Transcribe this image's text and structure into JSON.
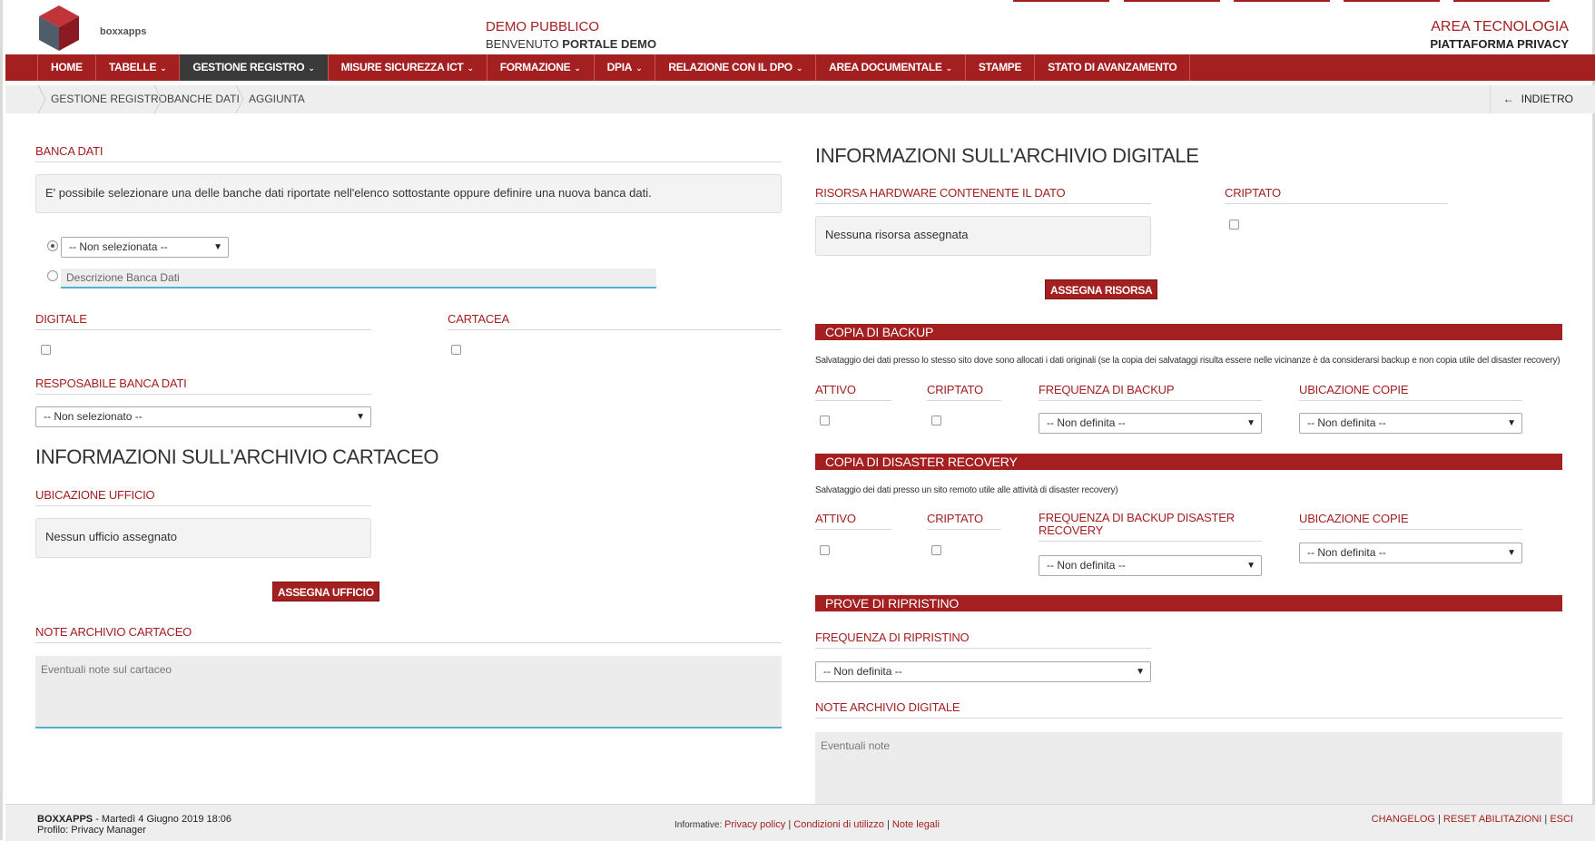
{
  "app": {
    "logo_text": "boxxapps",
    "demo_title": "DEMO PUBBLICO",
    "welcome_prefix": "BENVENUTO",
    "welcome_name": "PORTALE DEMO",
    "area_title": "AREA TECNOLOGIA",
    "area_subtitle": "PIATTAFORMA PRIVACY"
  },
  "nav": {
    "items": [
      {
        "label": "HOME",
        "dropdown": false
      },
      {
        "label": "TABELLE",
        "dropdown": true
      },
      {
        "label": "GESTIONE REGISTRO",
        "dropdown": true,
        "active": true
      },
      {
        "label": "MISURE SICUREZZA ICT",
        "dropdown": true
      },
      {
        "label": "FORMAZIONE",
        "dropdown": true
      },
      {
        "label": "DPIA",
        "dropdown": true
      },
      {
        "label": "RELAZIONE CON IL DPO",
        "dropdown": true
      },
      {
        "label": "AREA DOCUMENTALE",
        "dropdown": true
      },
      {
        "label": "STAMPE",
        "dropdown": false
      },
      {
        "label": "STATO DI AVANZAMENTO",
        "dropdown": false
      }
    ]
  },
  "breadcrumb": {
    "items": [
      "GESTIONE REGISTRO",
      "BANCHE DATI",
      "AGGIUNTA"
    ],
    "back_label": "INDIETRO"
  },
  "left": {
    "banca_dati_title": "BANCA DATI",
    "banca_dati_info": "E' possibile selezionare una delle banche dati riportate nell'elenco sottostante oppure definire una nuova banca dati.",
    "select_value": "-- Non selezionata --",
    "descr_placeholder": "Descrizione Banca Dati",
    "digitale_label": "DIGITALE",
    "cartacea_label": "CARTACEA",
    "responsabile_label": "RESPOSABILE BANCA DATI",
    "responsabile_value": "-- Non selezionato --",
    "archivio_cartaceo_title": "INFORMAZIONI SULL'ARCHIVIO CARTACEO",
    "ubicazione_label": "UBICAZIONE UFFICIO",
    "ubicazione_value": "Nessun ufficio assegnato",
    "assegna_ufficio": "ASSEGNA UFFICIO",
    "note_label": "NOTE ARCHIVIO CARTACEO",
    "note_placeholder": "Eventuali note sul cartaceo"
  },
  "right": {
    "archivio_digitale_title": "INFORMAZIONI SULL'ARCHIVIO DIGITALE",
    "risorsa_label": "RISORSA HARDWARE CONTENENTE IL DATO",
    "risorsa_value": "Nessuna risorsa assegnata",
    "criptato_label": "CRIPTATO",
    "assegna_risorsa": "ASSEGNA RISORSA",
    "backup": {
      "title": "COPIA DI BACKUP",
      "desc": "Salvataggio dei dati presso lo stesso sito dove sono allocati i dati originali (se la copia dei salvataggi risulta essere nelle vicinanze è da considerarsi backup e non copia utile del disaster recovery)",
      "attivo": "ATTIVO",
      "criptato": "CRIPTATO",
      "frequenza": "FREQUENZA DI BACKUP",
      "frequenza_value": "-- Non definita --",
      "ubicazione": "UBICAZIONE COPIE",
      "ubicazione_value": "-- Non definita --"
    },
    "dr": {
      "title": "COPIA DI DISASTER RECOVERY",
      "desc": "Salvataggio dei dati presso un sito remoto utile alle attività di disaster recovery)",
      "attivo": "ATTIVO",
      "criptato": "CRIPTATO",
      "frequenza_l1": "FREQUENZA DI BACKUP DISASTER",
      "frequenza_l2": "RECOVERY",
      "frequenza_value": "-- Non definita --",
      "ubicazione": "UBICAZIONE COPIE",
      "ubicazione_value": "-- Non definita --"
    },
    "ripristino": {
      "title": "PROVE DI RIPRISTINO",
      "frequenza": "FREQUENZA DI RIPRISTINO",
      "frequenza_value": "-- Non definita --"
    },
    "note_label": "NOTE ARCHIVIO DIGITALE",
    "note_placeholder": "Eventuali note"
  },
  "footer": {
    "brand": "BOXXAPPS",
    "datetime": " - Martedì 4 Giugno 2019 18:06",
    "profile": "Profilo: Privacy Manager",
    "info_label": "Informative: ",
    "privacy": "Privacy policy",
    "condizioni": "Condizioni di utilizzo",
    "note_legali": "Note legali",
    "changelog": "CHANGELOG",
    "reset": "RESET ABILITAZIONI",
    "esci": "ESCI"
  },
  "colors": {
    "brand_red": "#a41f1f",
    "active_nav": "#3a3a3a",
    "focus_line": "#4fb3c8"
  }
}
